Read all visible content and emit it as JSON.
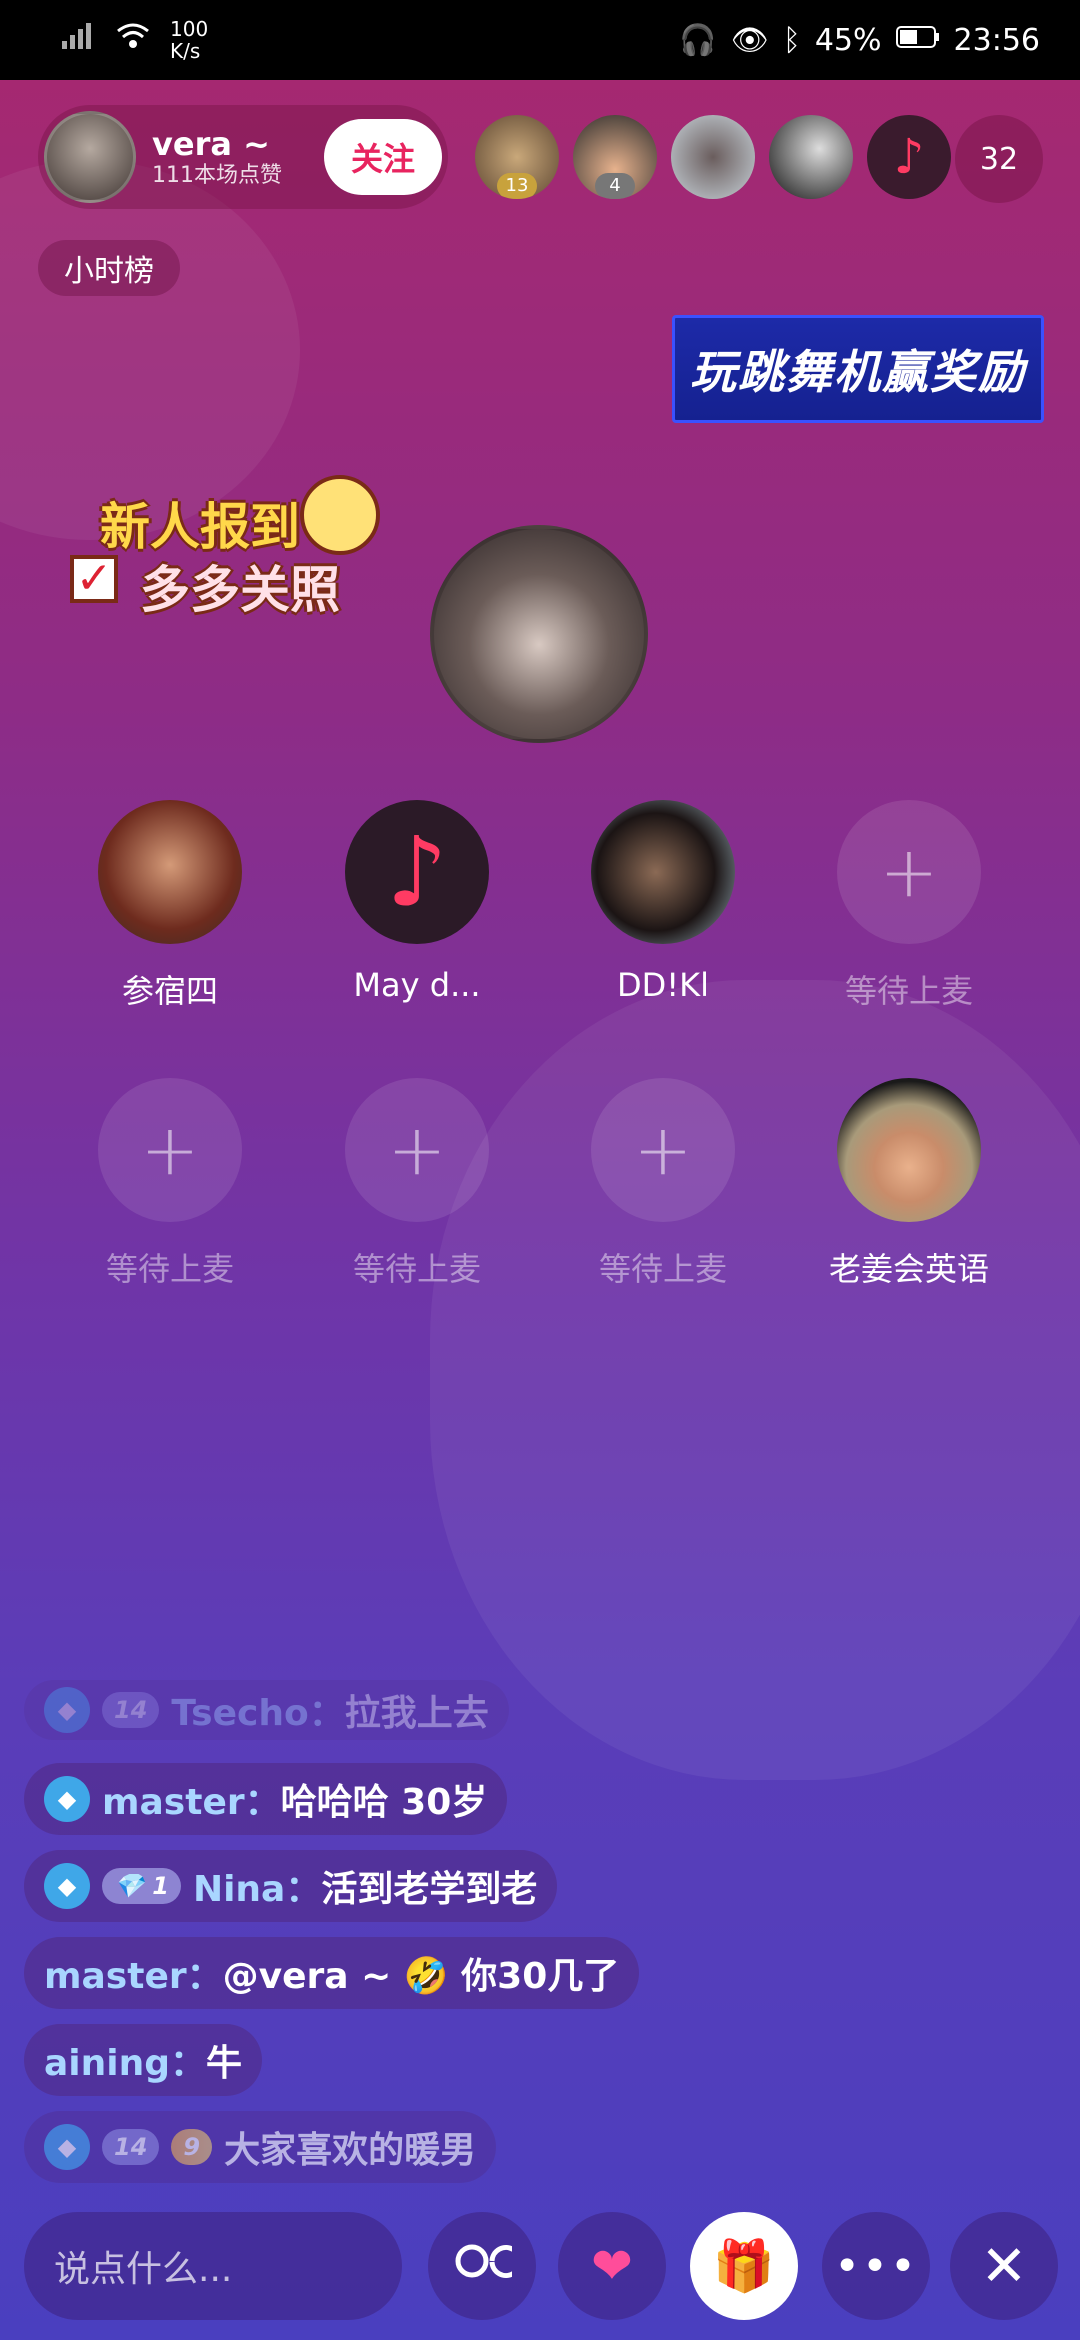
{
  "status_bar": {
    "net_speed_value": "100",
    "net_speed_unit": "K/s",
    "battery": "45%",
    "time": "23:56"
  },
  "host": {
    "name": "vera ~",
    "likes": "111本场点赞",
    "follow_label": "关注"
  },
  "audience": {
    "badges": [
      "13",
      "4"
    ],
    "count": "32"
  },
  "rank_label": "小时榜",
  "banner_text": "玩跳舞机赢奖励",
  "sticker": {
    "line1": "新人报到",
    "line2": "多多关照"
  },
  "seats": [
    {
      "label": "参宿四",
      "state": "occupied"
    },
    {
      "label": "May d...",
      "state": "occupied"
    },
    {
      "label": "DD!Kl",
      "state": "occupied"
    },
    {
      "label": "等待上麦",
      "state": "empty"
    },
    {
      "label": "等待上麦",
      "state": "empty"
    },
    {
      "label": "等待上麦",
      "state": "empty"
    },
    {
      "label": "等待上麦",
      "state": "empty"
    },
    {
      "label": "老姜会英语",
      "state": "occupied"
    }
  ],
  "chat": [
    {
      "name": "Tsecho：",
      "text": "拉我上去",
      "level": "14"
    },
    {
      "name": "master：",
      "text": "哈哈哈 30岁"
    },
    {
      "name": "Nina：",
      "text": "活到老学到老",
      "level": "1"
    },
    {
      "name": "master：",
      "text": "@vera ~ 🤣 你30几了"
    },
    {
      "name": "aining：",
      "text": "牛"
    },
    {
      "name": "",
      "text": "大家喜欢的暖男",
      "level": "14",
      "level2": "9"
    }
  ],
  "input_placeholder": "说点什么...",
  "colors": {
    "follow": "#e8245f",
    "chat_name": "#a9d6ff",
    "banner": "#1d2aa8"
  }
}
